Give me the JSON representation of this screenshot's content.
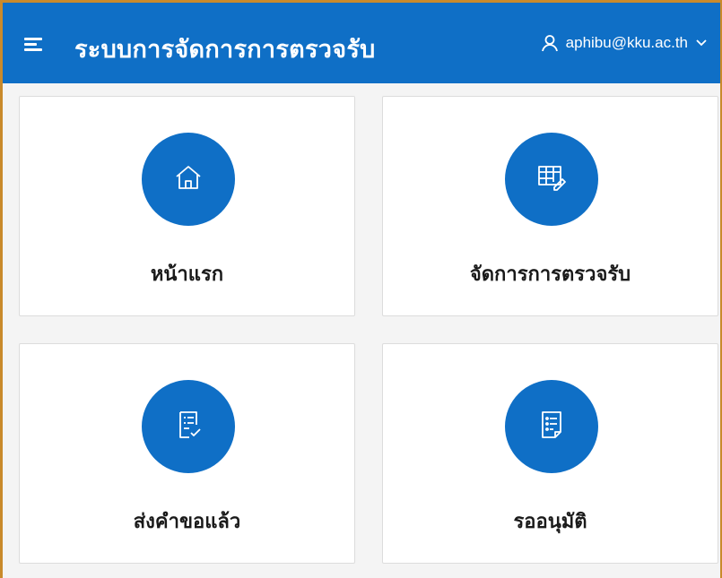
{
  "header": {
    "title": "ระบบการจัดการการตรวจรับ",
    "user_email": "aphibu@kku.ac.th"
  },
  "cards": [
    {
      "label": "หน้าแรก",
      "icon": "home-icon"
    },
    {
      "label": "จัดการการตรวจรับ",
      "icon": "table-edit-icon"
    },
    {
      "label": "ส่งคำขอแล้ว",
      "icon": "checklist-icon"
    },
    {
      "label": "รออนุมัติ",
      "icon": "list-document-icon"
    }
  ],
  "colors": {
    "primary": "#0f6fc6",
    "background": "#f4f4f4",
    "frame": "#c98a2b"
  }
}
